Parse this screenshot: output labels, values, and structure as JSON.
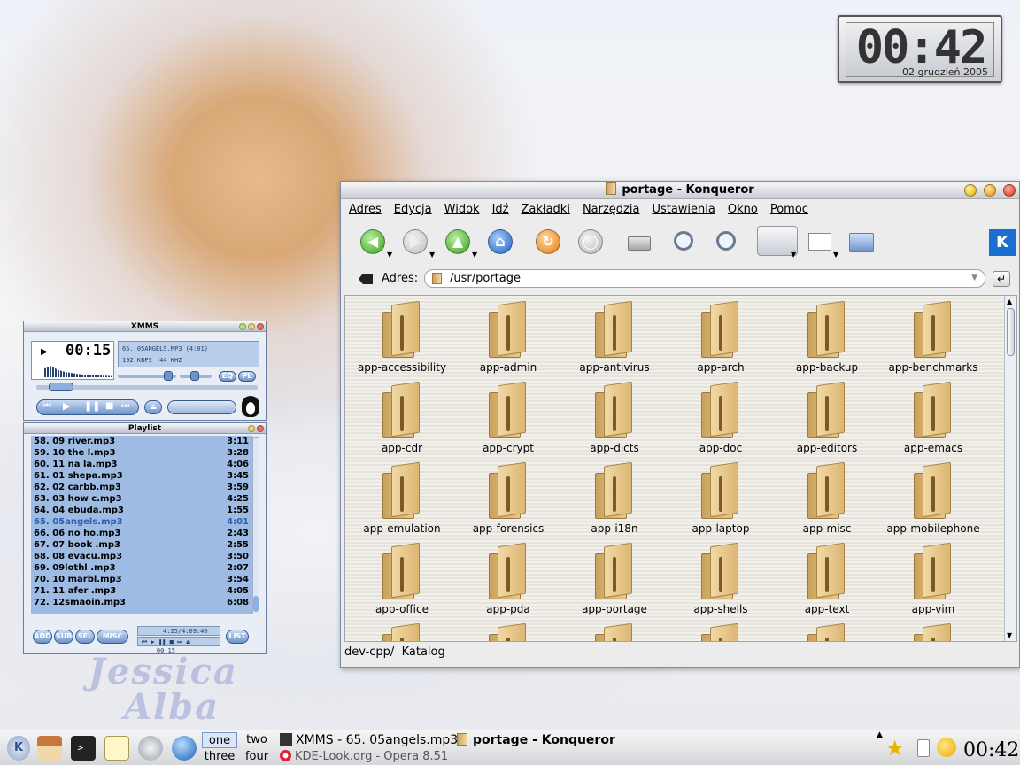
{
  "wallpaper": {
    "text_line1": "Jessica",
    "text_line2": "Alba"
  },
  "clock": {
    "time": "00:42",
    "date": "02 grudzień 2005"
  },
  "konqueror": {
    "title": "portage - Konqueror",
    "menu": [
      "Adres",
      "Edycja",
      "Widok",
      "Idź",
      "Zakładki",
      "Narzędzia",
      "Ustawienia",
      "Okno",
      "Pomoc"
    ],
    "address_label": "Adres:",
    "address_value": "/usr/portage",
    "folders": [
      "app-accessibility",
      "app-admin",
      "app-antivirus",
      "app-arch",
      "app-backup",
      "app-benchmarks",
      "app-cdr",
      "app-crypt",
      "app-dicts",
      "app-doc",
      "app-editors",
      "app-emacs",
      "app-emulation",
      "app-forensics",
      "app-i18n",
      "app-laptop",
      "app-misc",
      "app-mobilephone",
      "app-office",
      "app-pda",
      "app-portage",
      "app-shells",
      "app-text",
      "app-vim"
    ],
    "status_left": "dev-cpp/",
    "status_right": "Katalog"
  },
  "xmms": {
    "title": "XMMS",
    "time": "00:15",
    "song": "65. 05ANGELS.MP3  (4:01)",
    "kbps": "192 KBPS",
    "khz": "44 KHZ",
    "eq_btn": "EQ",
    "pl_btn": "PL",
    "playlist_title": "Playlist",
    "playlist": [
      {
        "name": "58. 09 river.mp3",
        "dur": "3:11"
      },
      {
        "name": "59. 10 the l.mp3",
        "dur": "3:28"
      },
      {
        "name": "60. 11 na la.mp3",
        "dur": "4:06"
      },
      {
        "name": "61. 01 shepa.mp3",
        "dur": "3:45"
      },
      {
        "name": "62. 02 carbb.mp3",
        "dur": "3:59"
      },
      {
        "name": "63. 03 how c.mp3",
        "dur": "4:25"
      },
      {
        "name": "64. 04 ebuda.mp3",
        "dur": "1:55"
      },
      {
        "name": "65. 05angels.mp3",
        "dur": "4:01"
      },
      {
        "name": "66. 06 no ho.mp3",
        "dur": "2:43"
      },
      {
        "name": "67. 07 book .mp3",
        "dur": "2:55"
      },
      {
        "name": "68. 08 evacu.mp3",
        "dur": "3:50"
      },
      {
        "name": "69. 09lothl .mp3",
        "dur": "2:07"
      },
      {
        "name": "70. 10 marbl.mp3",
        "dur": "3:54"
      },
      {
        "name": "71. 11 afer .mp3",
        "dur": "4:05"
      },
      {
        "name": "72. 12smaoin.mp3",
        "dur": "6:08"
      }
    ],
    "pl_buttons": [
      "ADD",
      "SUB",
      "SEL",
      "MISC"
    ],
    "pl_info": "4:25/4:09:40",
    "pl_time": "00:15",
    "list_btn": "LIST"
  },
  "taskbar": {
    "pager": [
      "one",
      "two",
      "three",
      "four"
    ],
    "tasks": [
      {
        "label": "XMMS - 65. 05angels.mp3"
      },
      {
        "label": "portage - Konqueror"
      },
      {
        "label": "KDE-Look.org - Opera 8.51"
      }
    ],
    "clock": "00:42"
  }
}
